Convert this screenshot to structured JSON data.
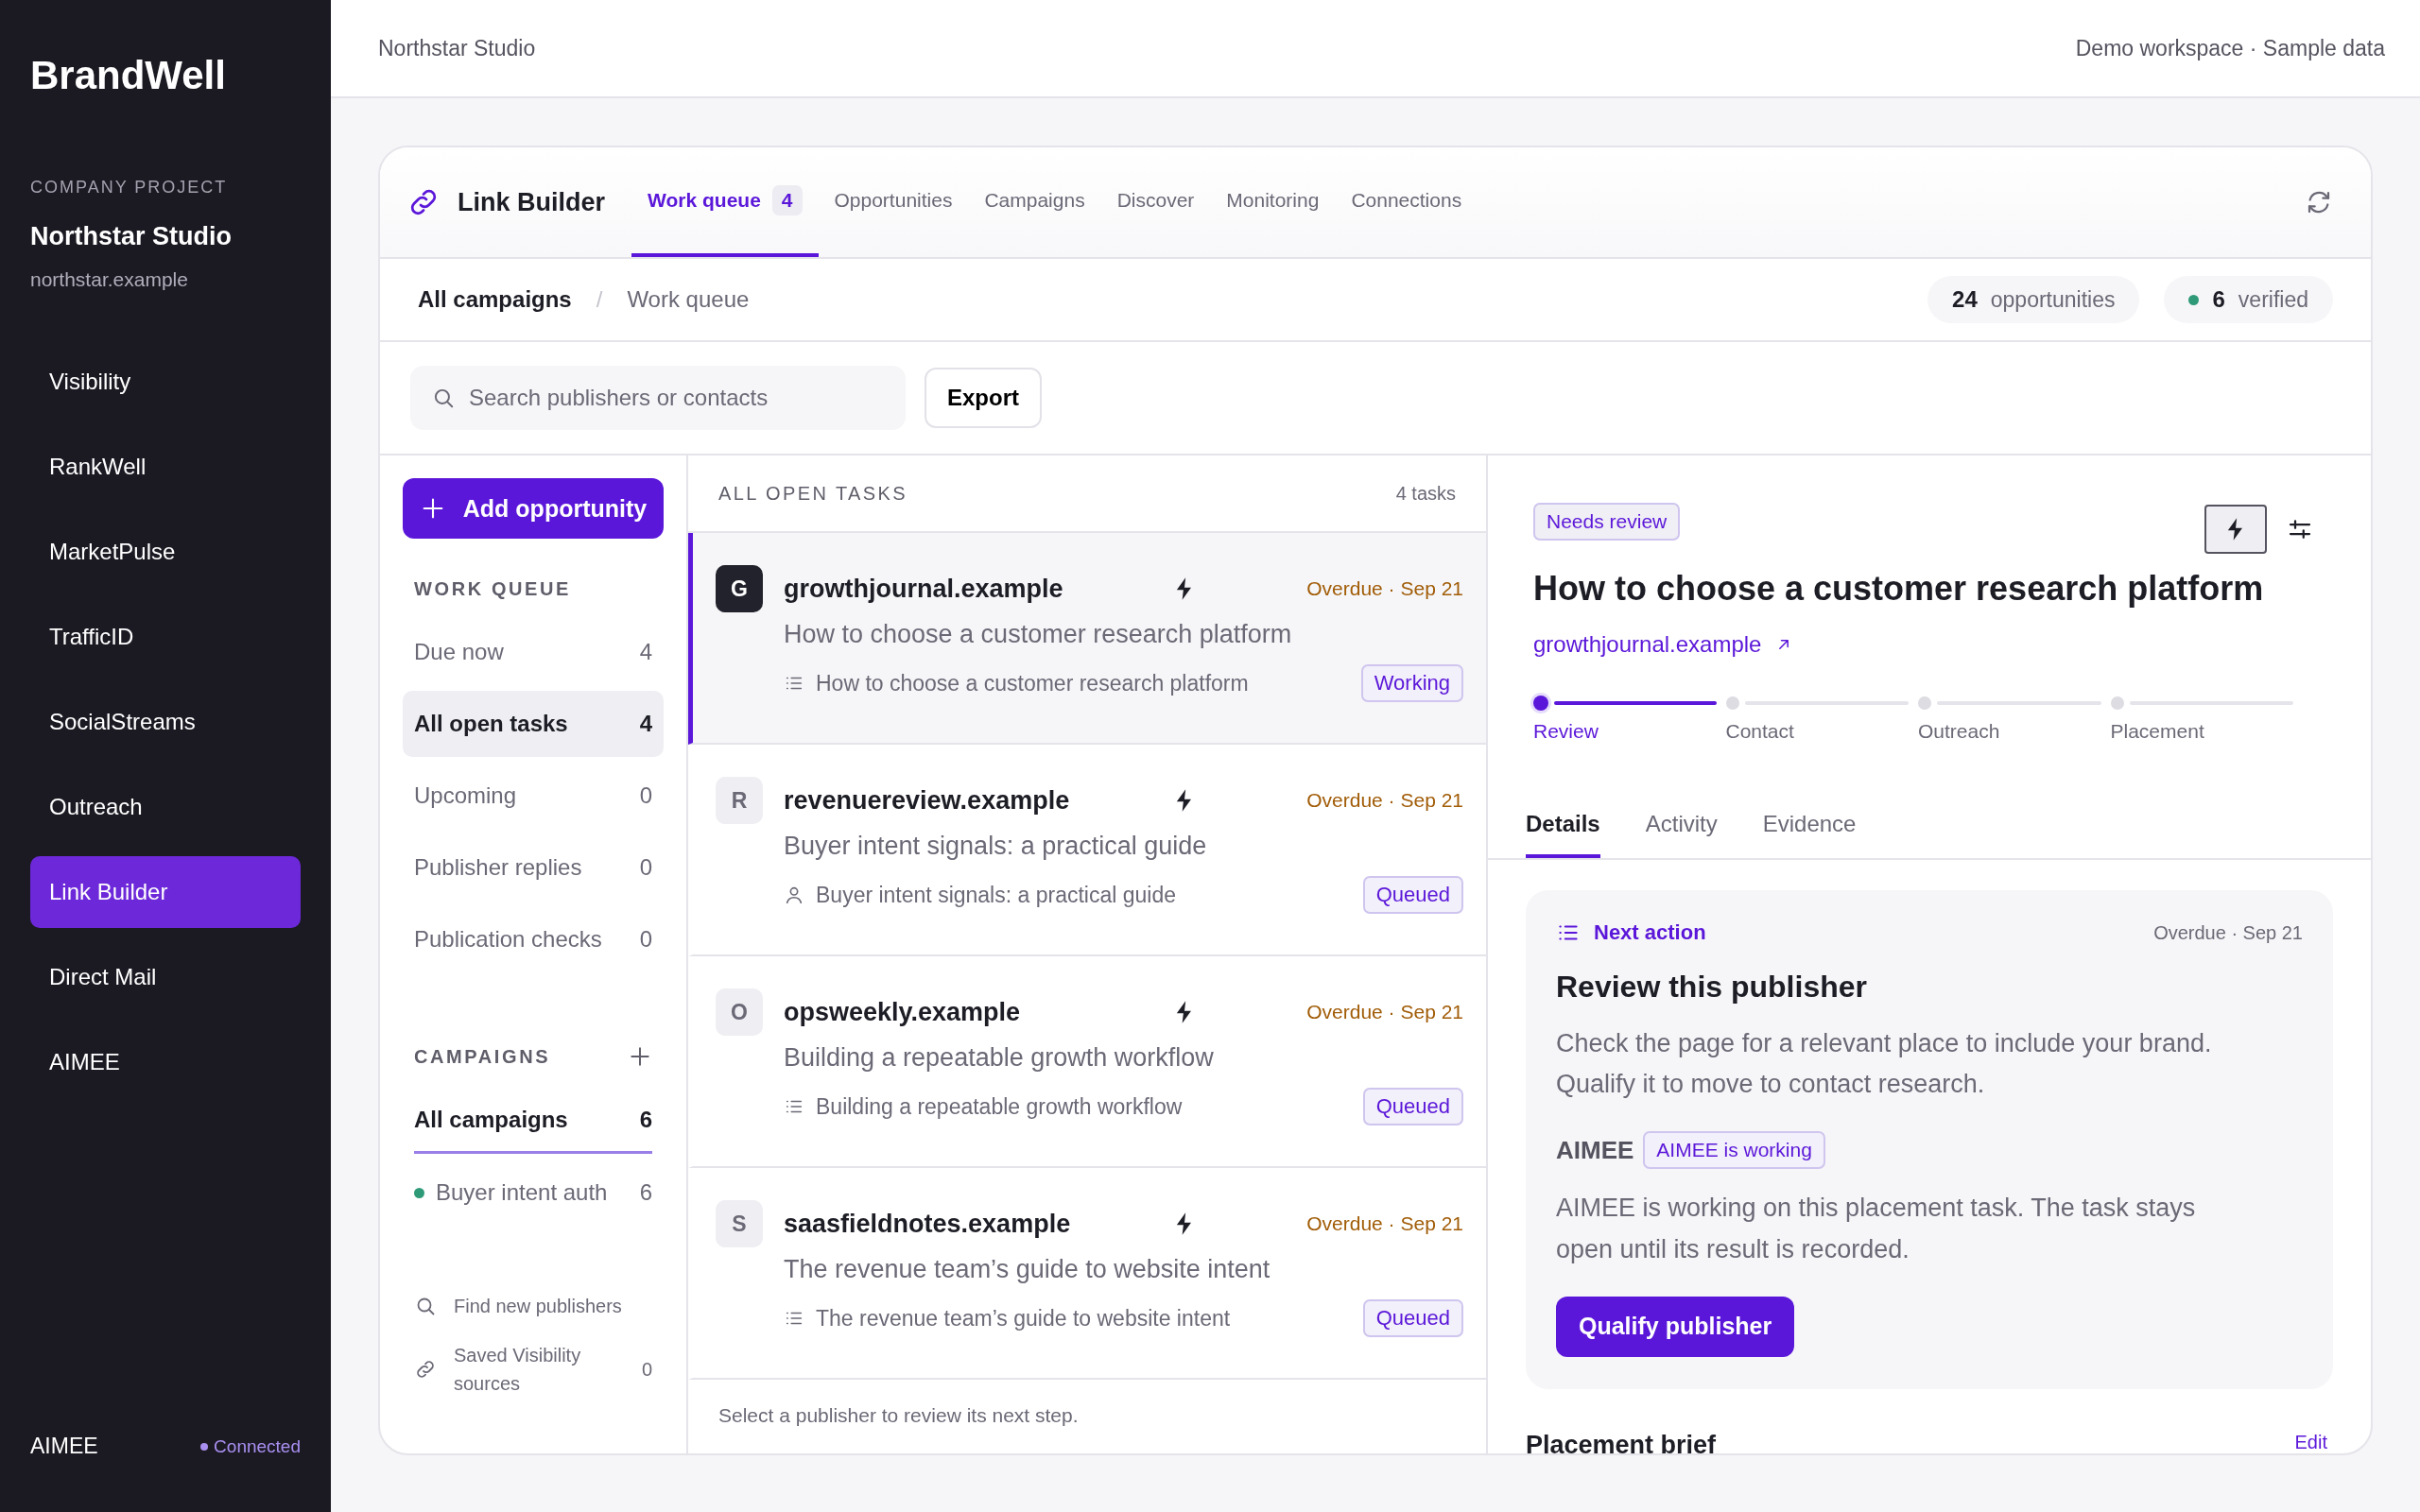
{
  "sidebar": {
    "brand": "BrandWell",
    "project_label": "COMPANY PROJECT",
    "project_name": "Northstar Studio",
    "project_domain": "northstar.example",
    "items": [
      {
        "label": "Visibility",
        "selected": false
      },
      {
        "label": "RankWell",
        "selected": false
      },
      {
        "label": "MarketPulse",
        "selected": false
      },
      {
        "label": "TrafficID",
        "selected": false
      },
      {
        "label": "SocialStreams",
        "selected": false
      },
      {
        "label": "Outreach",
        "selected": false
      },
      {
        "label": "Link Builder",
        "selected": true
      },
      {
        "label": "Direct Mail",
        "selected": false
      },
      {
        "label": "AIMEE",
        "selected": false
      }
    ],
    "footer": {
      "label": "AIMEE",
      "status": "Connected"
    }
  },
  "topbar": {
    "title": "Northstar Studio",
    "meta": "Demo workspace · Sample data"
  },
  "module": {
    "title": "Link Builder",
    "tabs": [
      {
        "label": "Work queue",
        "count": "4",
        "selected": true
      },
      {
        "label": "Opportunities",
        "selected": false
      },
      {
        "label": "Campaigns",
        "selected": false
      },
      {
        "label": "Discover",
        "selected": false
      },
      {
        "label": "Monitoring",
        "selected": false
      },
      {
        "label": "Connections",
        "selected": false
      }
    ]
  },
  "breadcrumb": {
    "items": [
      "All campaigns",
      "Work queue"
    ],
    "separator": "/"
  },
  "stats": [
    {
      "value": "24",
      "label": "opportunities"
    },
    {
      "value": "6",
      "label": "verified",
      "color": "#2f9a77"
    }
  ],
  "search": {
    "placeholder": "Search publishers or contacts"
  },
  "export_button": "Export",
  "add_button": "Add opportunity",
  "work_queue": {
    "heading": "WORK QUEUE",
    "items": [
      {
        "label": "Due now",
        "count": "4",
        "selected": false
      },
      {
        "label": "All open tasks",
        "count": "4",
        "selected": true
      },
      {
        "label": "Upcoming",
        "count": "0",
        "selected": false
      },
      {
        "label": "Publisher replies",
        "count": "0",
        "selected": false
      },
      {
        "label": "Publication checks",
        "count": "0",
        "selected": false
      }
    ]
  },
  "campaigns": {
    "heading": "CAMPAIGNS",
    "items": [
      {
        "label": "All campaigns",
        "count": "6",
        "selected": true
      },
      {
        "label": "Buyer intent auth",
        "count": "6",
        "selected": false,
        "color": "#2f9a77"
      }
    ]
  },
  "links": [
    {
      "kind": "search",
      "label": "Find new publishers"
    },
    {
      "kind": "link",
      "label": "Saved Visibility sources",
      "count": "0"
    }
  ],
  "tasks": {
    "heading": "ALL OPEN TASKS",
    "count": "4 tasks",
    "items": [
      {
        "initial": "G",
        "domain": "growthjournal.example",
        "due": "Overdue · Sep 21",
        "title": "How to choose a customer research platform",
        "subtitle": "How to choose a customer research platform",
        "kind": "list",
        "status": "Working",
        "selected": true
      },
      {
        "initial": "R",
        "domain": "revenuereview.example",
        "due": "Overdue · Sep 21",
        "title": "Buyer intent signals: a practical guide",
        "subtitle": "Buyer intent signals: a practical guide",
        "kind": "person",
        "status": "Queued",
        "selected": false
      },
      {
        "initial": "O",
        "domain": "opsweekly.example",
        "due": "Overdue · Sep 21",
        "title": "Building a repeatable growth workflow",
        "subtitle": "Building a repeatable growth workflow",
        "kind": "list",
        "status": "Queued",
        "selected": false
      },
      {
        "initial": "S",
        "domain": "saasfieldnotes.example",
        "due": "Overdue · Sep 21",
        "title": "The revenue team’s guide to website intent",
        "subtitle": "The revenue team’s guide to website intent",
        "kind": "list",
        "status": "Queued",
        "selected": false
      }
    ],
    "footer": "Select a publisher to review its next step."
  },
  "detail": {
    "badge": "Needs review",
    "title": "How to choose a customer research platform",
    "link": "growthjournal.example",
    "steps": [
      {
        "label": "Review",
        "selected": true
      },
      {
        "label": "Contact",
        "selected": false
      },
      {
        "label": "Outreach",
        "selected": false
      },
      {
        "label": "Placement",
        "selected": false
      }
    ],
    "tabs": [
      {
        "label": "Details",
        "selected": true
      },
      {
        "label": "Activity",
        "selected": false
      },
      {
        "label": "Evidence",
        "selected": false
      }
    ],
    "next_action": {
      "label": "Next action",
      "due": "Overdue · Sep 21",
      "title": "Review this publisher",
      "text": "Check the page for a relevant place to include your brand. Qualify it to move to contact research.",
      "agent": "AIMEE",
      "agent_badge": "AIMEE is working",
      "note": "AIMEE is working on this placement task. The task stays open until its result is recorded.",
      "button": "Qualify publisher"
    },
    "brief": {
      "title": "Placement brief",
      "action": "Edit"
    }
  }
}
